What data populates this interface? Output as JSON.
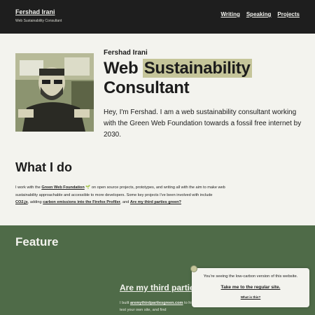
{
  "header": {
    "site_name": "Fershad Irani",
    "tagline": "Web Sustainability Consultant",
    "nav": [
      "Writing",
      "Speaking",
      "Projects"
    ]
  },
  "hero": {
    "name": "Fershad Irani",
    "title_part1": "Web",
    "title_highlight": "Sustainability",
    "title_part2": "Consultant",
    "bio": "Hey, I'm Fershad. I am a web sustainability consultant working with the Green Web Foundation towards a fossil free internet by 2030."
  },
  "what_i_do": {
    "heading": "What I do",
    "text_1": "I work with the ",
    "link_gwf": "Green Web Foundation",
    "text_2": " on open source projects, prototypes, and writing all with the aim to make web sustainability approachable and accessible to more developers. Some key projects I've been involved with include ",
    "link_co2": "CO2.js",
    "text_3": ", adding ",
    "link_firefox": "carbon emissions into the Firefox Profiler",
    "text_4": ", and ",
    "link_third": "Are my third parties green?"
  },
  "feature": {
    "heading": "Feature",
    "subtitle": "Are my third parties green?",
    "text_1": "I built ",
    "link": "aremythirdpartiesgreen.com",
    "text_2": " to highlight the sustainability of third-party requests on the web. Use it to test your own site, and find"
  },
  "popup": {
    "message": "You're seeing the low-carbon version of this website.",
    "link": "Take me to the regular site.",
    "small_link": "What is this?"
  },
  "colors": {
    "header_bg": "#1e1e1e",
    "page_bg": "#f3f3ee",
    "feature_bg": "#4f6b48",
    "highlight": "#c5c59a"
  }
}
